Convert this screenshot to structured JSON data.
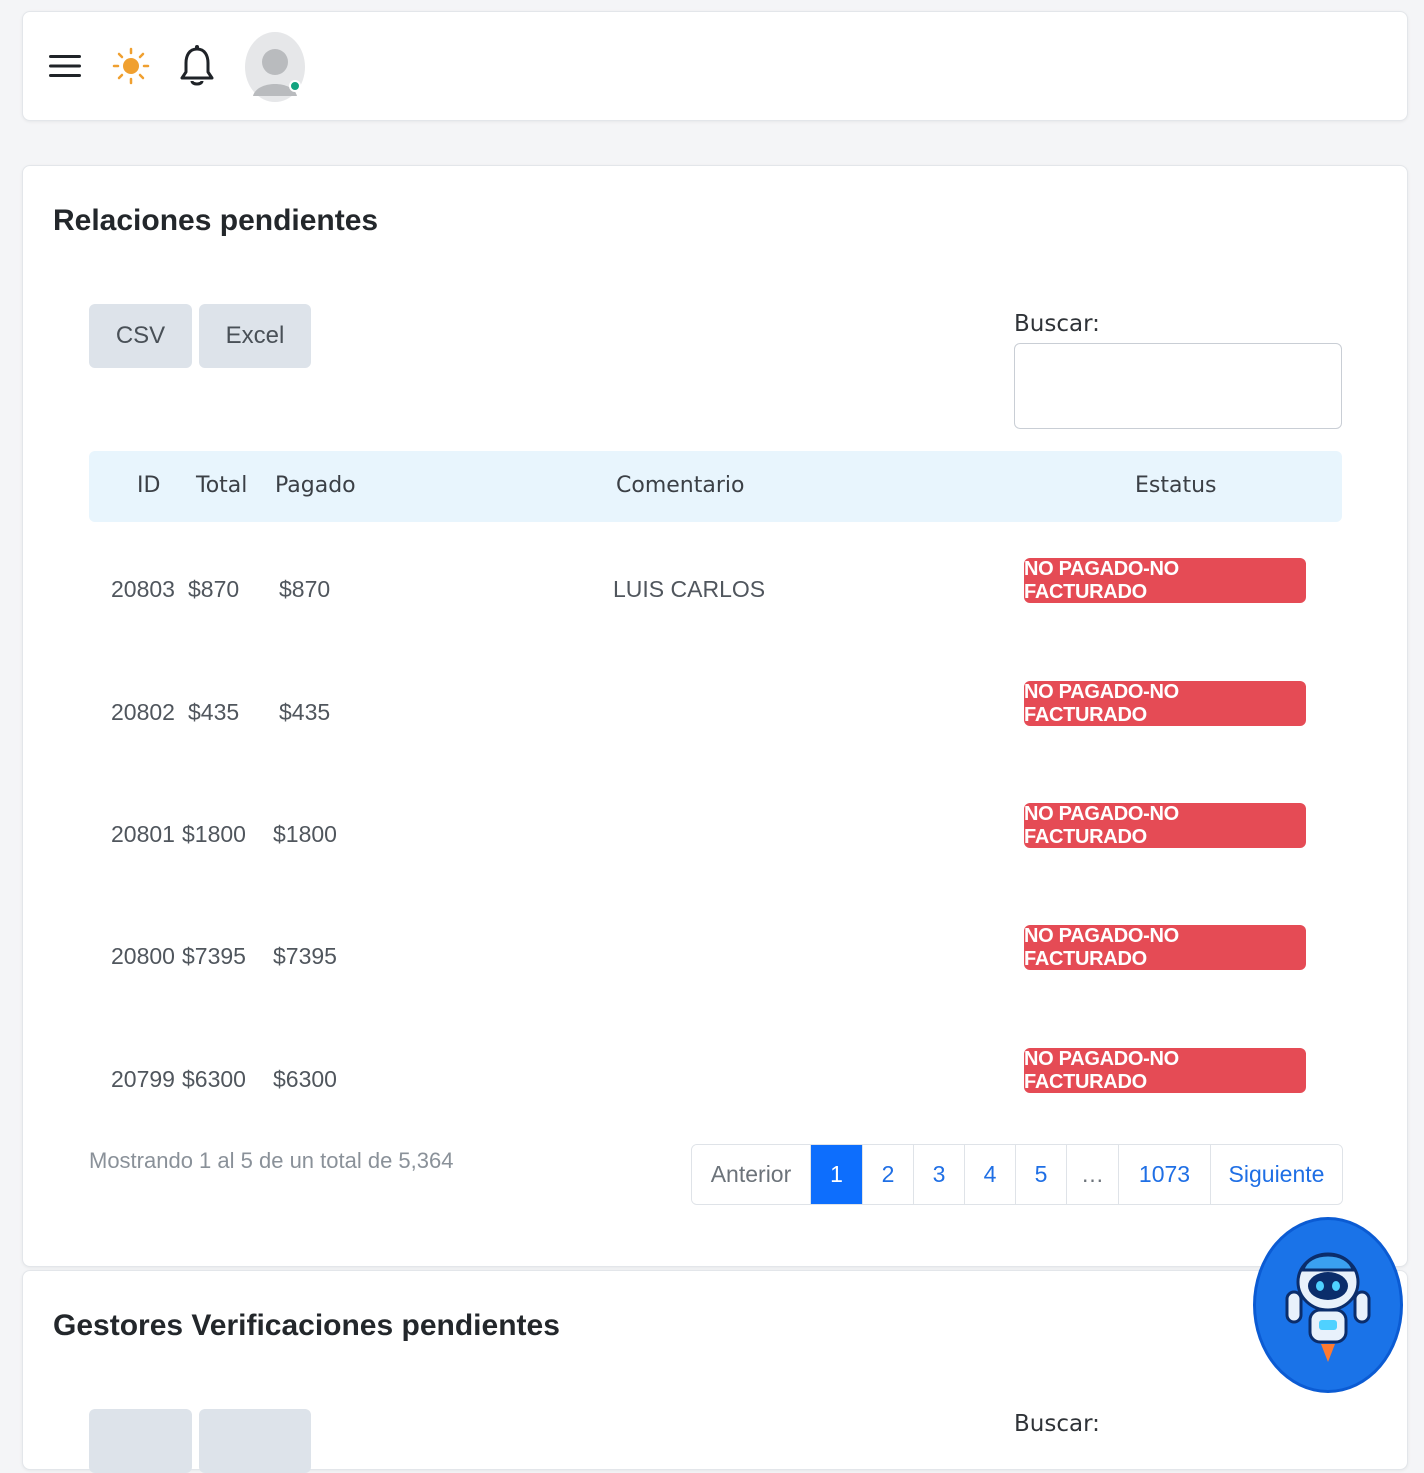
{
  "topbar": {
    "icons": [
      "menu-icon",
      "sun-icon",
      "bell-icon",
      "avatar"
    ],
    "colors": {
      "sun": "#f0a030",
      "online": "#12a37f"
    }
  },
  "section1": {
    "title": "Relaciones pendientes",
    "buttons": {
      "csv": "CSV",
      "excel": "Excel"
    },
    "search_label": "Buscar:",
    "search_value": "",
    "columns": [
      "ID",
      "Total",
      "Pagado",
      "Comentario",
      "Estatus"
    ],
    "rows": [
      {
        "id": "20803",
        "total": "$870",
        "pagado": "$870",
        "comentario": "LUIS CARLOS",
        "estatus": "NO PAGADO-NO FACTURADO"
      },
      {
        "id": "20802",
        "total": "$435",
        "pagado": "$435",
        "comentario": "",
        "estatus": "NO PAGADO-NO FACTURADO"
      },
      {
        "id": "20801",
        "total": "$1800",
        "pagado": "$1800",
        "comentario": "",
        "estatus": "NO PAGADO-NO FACTURADO"
      },
      {
        "id": "20800",
        "total": "$7395",
        "pagado": "$7395",
        "comentario": "",
        "estatus": "NO PAGADO-NO FACTURADO"
      },
      {
        "id": "20799",
        "total": "$6300",
        "pagado": "$6300",
        "comentario": "",
        "estatus": "NO PAGADO-NO FACTURADO"
      }
    ],
    "info": "Mostrando 1 al 5 de un total de 5,364",
    "pagination": {
      "prev": "Anterior",
      "pages": [
        "1",
        "2",
        "3",
        "4",
        "5",
        "…",
        "1073"
      ],
      "next": "Siguiente",
      "active": "1"
    },
    "status_color": "#e54b55"
  },
  "section2": {
    "title": "Gestores Verificaciones pendientes",
    "search_label": "Buscar:"
  }
}
